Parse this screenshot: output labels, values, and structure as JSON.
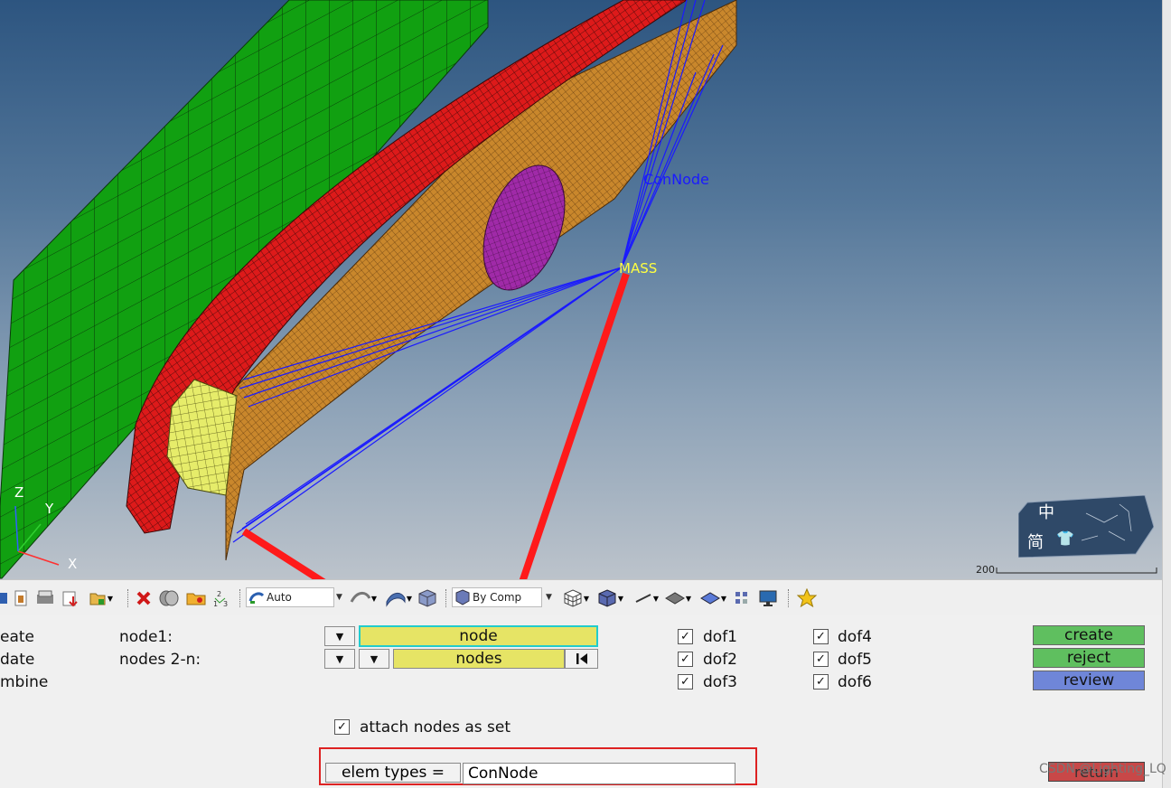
{
  "viewport": {
    "labels": {
      "connode": "ConNode",
      "mass": "MASS"
    },
    "axes": {
      "x": "X",
      "y": "Y",
      "z": "Z"
    },
    "scale_label": "200",
    "nav_glyphs": {
      "top": "中",
      "bottom": "简"
    }
  },
  "toolbar": {
    "auto_select": "Auto",
    "color_by_select": "By Comp"
  },
  "panel": {
    "menu_partial": [
      "eate",
      "date",
      "mbine"
    ],
    "node1_label": "node1:",
    "nodes_label": "nodes 2-n:",
    "node_selector": "node",
    "nodes_selector": "nodes",
    "dofs": [
      {
        "label": "dof1",
        "checked": true
      },
      {
        "label": "dof2",
        "checked": true
      },
      {
        "label": "dof3",
        "checked": true
      },
      {
        "label": "dof4",
        "checked": true
      },
      {
        "label": "dof5",
        "checked": true
      },
      {
        "label": "dof6",
        "checked": true
      }
    ],
    "checkmark": "✓",
    "attach_label": "attach nodes as set",
    "elem_types_label": "elem types =",
    "elem_types_value": "ConNode",
    "buttons": {
      "create": "create",
      "reject": "reject",
      "review": "review",
      "return": "return"
    },
    "watermark": "CSDN @Lighting_LQ"
  },
  "colors": {
    "create": "#5fbf5f",
    "reject": "#5fbf5f",
    "review": "#6f86d8",
    "return": "#c84848",
    "selector": "#e6e465",
    "annotation": "#dd2222"
  }
}
